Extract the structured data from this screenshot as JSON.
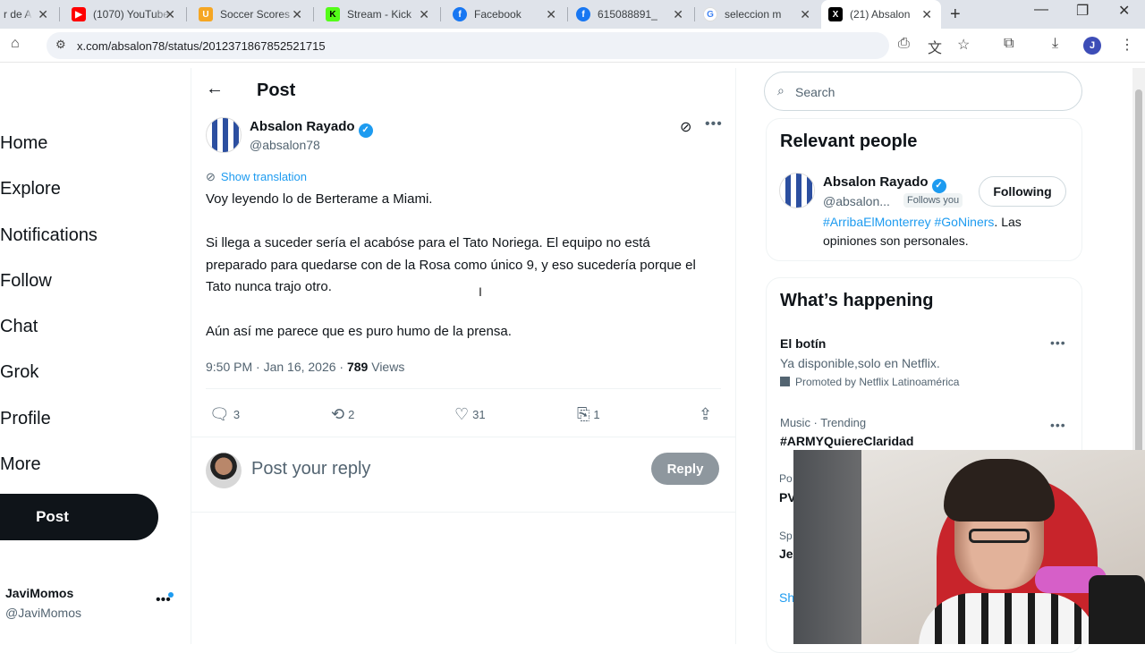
{
  "browser": {
    "tabs": [
      {
        "title": "r de A",
        "favicon_color": "#c21"
      },
      {
        "title": "(1070) YouTube",
        "favicon_color": "#f00"
      },
      {
        "title": "Soccer Scores",
        "favicon_color": "#f5a623"
      },
      {
        "title": "Stream - Kick",
        "favicon_color": "#53fc18"
      },
      {
        "title": "Facebook",
        "favicon_color": "#1877f2"
      },
      {
        "title": "615088891_",
        "favicon_color": "#1877f2"
      },
      {
        "title": "seleccion m",
        "favicon_color": "#4285f4"
      },
      {
        "title": "(21) Absalon",
        "favicon_color": "#000",
        "active": true
      }
    ],
    "url": "x.com/absalon78/status/2012371867852521715",
    "profile_initial": "J"
  },
  "nav": {
    "items": [
      "Home",
      "Explore",
      "Notifications",
      "Follow",
      "Chat",
      "Grok",
      "Profile",
      "More"
    ],
    "post_label": "Post",
    "account_name": "JaviMomos",
    "account_handle": "@JaviMomos"
  },
  "post": {
    "header_title": "Post",
    "author_name": "Absalon Rayado",
    "author_handle": "@absalon78",
    "show_translation": "Show translation",
    "paragraphs": [
      "Voy leyendo lo de Berterame a Miami.",
      "Si llega a suceder sería el acabóse para el Tato Noriega. El equipo no está preparado para quedarse con de la Rosa como único 9, y eso sucedería porque el Tato nunca trajo otro.",
      "Aún así me parece que es puro humo de la prensa."
    ],
    "time": "9:50 PM · Jan 16, 2026 · ",
    "views_count": "789",
    "views_label": "Views",
    "replies": "3",
    "reposts": "2",
    "likes": "31",
    "bookmarks": "1",
    "reply_placeholder": "Post your reply",
    "reply_button": "Reply"
  },
  "sidebar": {
    "search_placeholder": "Search",
    "relevant_title": "Relevant people",
    "person_name": "Absalon Rayado",
    "person_handle": "@absalon...",
    "follows_you": "Follows you",
    "following_label": "Following",
    "bio_tag1": "#ArribaElMonterrey",
    "bio_tag2": "#GoNiners",
    "bio_rest": ". Las opiniones son personales.",
    "happening_title": "What’s happening",
    "trend1_title": "El botín",
    "trend1_sub": "Ya disponible,solo en Netflix.",
    "trend1_promo": "Promoted by Netflix Latinoamérica",
    "trend2_label": "Music · Trending",
    "trend2_title": "#ARMYQuiereClaridad",
    "cut_po": "Po",
    "cut_pv": "PV",
    "cut_sp": "Sp",
    "cut_je": "Je",
    "cut_sh": "Sh"
  }
}
